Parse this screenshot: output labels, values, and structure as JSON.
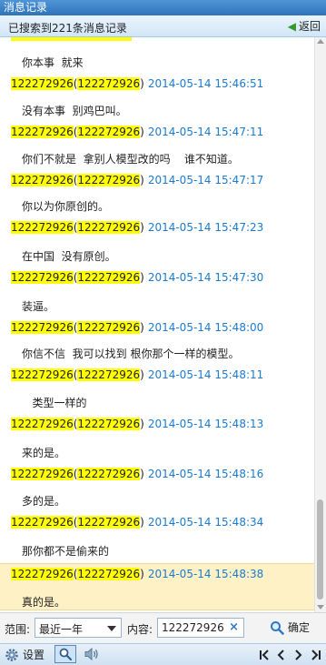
{
  "window": {
    "title": "消息记录"
  },
  "header": {
    "summary": "已搜索到221条消息记录",
    "back_label": "返回"
  },
  "contact": {
    "id": "122272926",
    "nick": "122272926"
  },
  "messages": [
    {
      "text": "你本事  就来",
      "time": "2014-05-14 15:46:51"
    },
    {
      "text": "没有本事  别鸡巴叫。",
      "time": "2014-05-14 15:47:11"
    },
    {
      "text": "你们不就是  拿别人模型改的吗    谁不知道。",
      "time": "2014-05-14 15:47:17"
    },
    {
      "text": "你以为你原创的。",
      "time": "2014-05-14 15:47:23"
    },
    {
      "text": "在中国  没有原创。",
      "time": "2014-05-14 15:47:30"
    },
    {
      "text": "装逼。",
      "time": "2014-05-14 15:48:00"
    },
    {
      "text": "你信不信  我可以找到 根你那个一样的模型。",
      "time": "2014-05-14 15:48:11"
    },
    {
      "text": "   类型一样的",
      "time": "2014-05-14 15:48:13"
    },
    {
      "text": "来的是。",
      "time": "2014-05-14 15:48:16"
    },
    {
      "text": "多的是。",
      "time": "2014-05-14 15:48:34"
    },
    {
      "text": "那你都不是偷来的",
      "time": "2014-05-14 15:48:38"
    },
    {
      "text": "真的是。",
      "time": ""
    }
  ],
  "filter": {
    "range_label": "范围:",
    "range_value": "最近一年",
    "content_label": "内容:",
    "content_value": "122272926",
    "confirm_label": "确定"
  },
  "toolbar": {
    "settings_label": "设置"
  },
  "colors": {
    "highlight": "#ffff00",
    "timestamp": "#1c7bd0",
    "selected_row": "#fff1c6"
  }
}
